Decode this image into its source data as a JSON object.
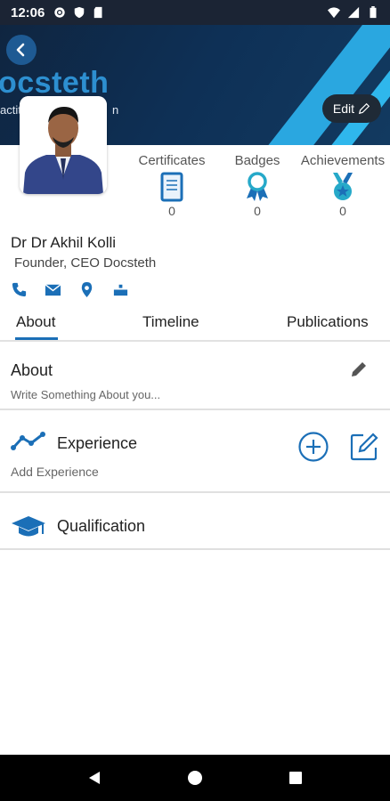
{
  "status_bar": {
    "time": "12:06"
  },
  "header": {
    "banner_title": "ocsteth",
    "banner_subtitle": "actitio",
    "banner_subtitle_right": "n",
    "edit_label": "Edit"
  },
  "stats": [
    {
      "label": "Certificates",
      "count": "0",
      "icon": "certificate-icon"
    },
    {
      "label": "Badges",
      "count": "0",
      "icon": "badge-ribbon-icon"
    },
    {
      "label": "Achievements",
      "count": "0",
      "icon": "medal-icon"
    }
  ],
  "profile": {
    "name": "Dr Dr Akhil Kolli",
    "title": "Founder, CEO Docsteth",
    "contact_icons": [
      "phone-icon",
      "email-icon",
      "location-icon",
      "id-badge-icon"
    ]
  },
  "tabs": [
    {
      "label": "About",
      "active": true
    },
    {
      "label": "Timeline",
      "active": false
    },
    {
      "label": "Publications",
      "active": false
    }
  ],
  "sections": {
    "about": {
      "title": "About",
      "subtitle": "Write Something About you..."
    },
    "experience": {
      "title": "Experience",
      "subtitle": "Add Experience"
    },
    "qualification": {
      "title": "Qualification"
    }
  },
  "colors": {
    "accent": "#1b6fb7",
    "banner_dark": "#0f2540",
    "banner_stripe": "#2aa7e0",
    "badge_teal": "#26a9c9"
  }
}
